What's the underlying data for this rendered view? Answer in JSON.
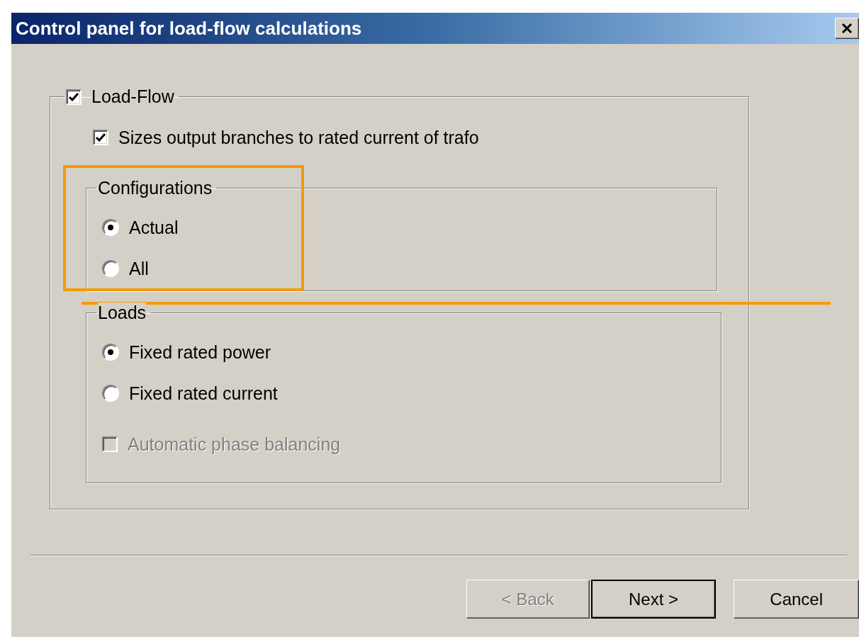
{
  "window": {
    "title": "Control panel for load-flow calculations"
  },
  "load_flow": {
    "label": "Load-Flow",
    "checked": true,
    "options": [
      {
        "kind": "checkbox",
        "label": "Sizes output branches to rated current of trafo",
        "checked": true,
        "disabled": false
      }
    ],
    "groups": [
      {
        "title": "Configurations",
        "items": [
          {
            "kind": "radio",
            "label": "Actual",
            "selected": true
          },
          {
            "kind": "radio",
            "label": "All",
            "selected": false
          }
        ]
      },
      {
        "title": "Loads",
        "items": [
          {
            "kind": "radio",
            "label": "Fixed rated power",
            "selected": true
          },
          {
            "kind": "radio",
            "label": "Fixed rated current",
            "selected": false
          },
          {
            "kind": "checkbox",
            "label": "Automatic phase balancing",
            "checked": false,
            "disabled": true
          }
        ]
      }
    ]
  },
  "buttons": [
    {
      "label": "< Back",
      "disabled": true,
      "default": false
    },
    {
      "label": "Next >",
      "disabled": false,
      "default": true
    },
    {
      "label": "Cancel",
      "disabled": false,
      "default": false
    }
  ]
}
